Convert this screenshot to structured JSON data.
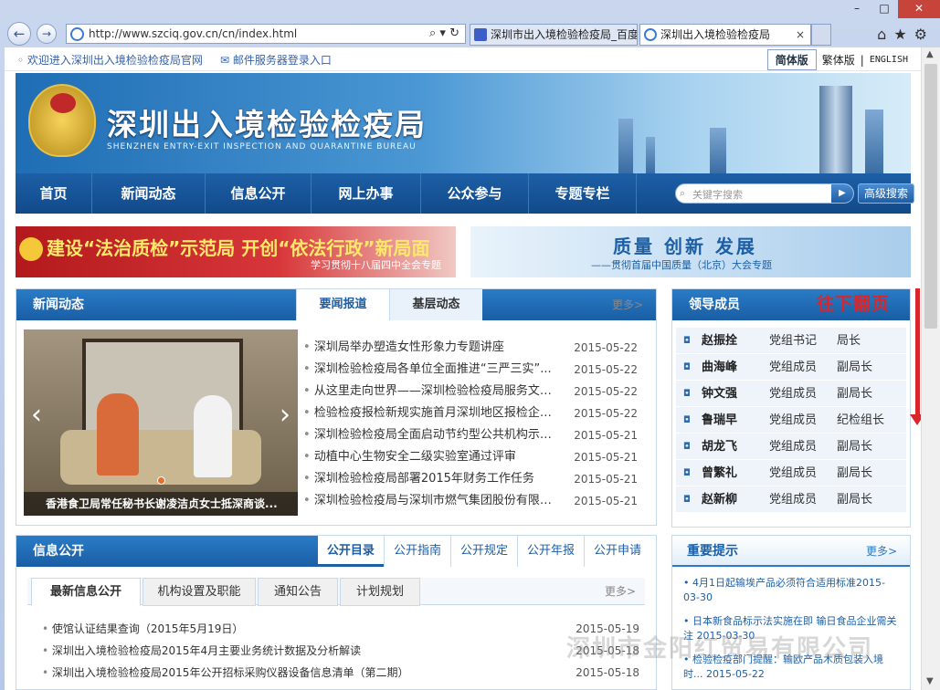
{
  "browser": {
    "url": "http://www.szciq.gov.cn/cn/index.html",
    "tabs": [
      {
        "label": "深圳市出入境检验检疫局_百度..."
      },
      {
        "label": "深圳出入境检验检疫局",
        "close": "×"
      }
    ],
    "nav": {
      "back": "←",
      "forward": "→",
      "refresh": "↻",
      "search": "⌕"
    },
    "window": {
      "min": "–",
      "max": "□",
      "close": "✕"
    },
    "tools": {
      "home": "⌂",
      "fav": "★",
      "settings": "⚙"
    }
  },
  "topbar": {
    "welcome": "欢迎进入深圳出入境检验检疫局官网",
    "mail": "邮件服务器登录入口",
    "lang_simplified": "简体版",
    "lang_traditional": "繁体版",
    "lang_sep": "|",
    "lang_english": "ENGLISH"
  },
  "header": {
    "title": "深圳出入境检验检疫局",
    "subtitle": "SHENZHEN ENTRY-EXIT INSPECTION AND QUARANTINE BUREAU"
  },
  "mainnav": {
    "items": [
      "首页",
      "新闻动态",
      "信息公开",
      "网上办事",
      "公众参与",
      "专题专栏"
    ],
    "search_placeholder": "关键字搜索",
    "search_go": "▶",
    "advanced": "高级搜索"
  },
  "promo": {
    "left_title": "建设“法治质检”示范局 开创“依法行政”新局面",
    "left_sub": "学习贯彻十八届四中全会专题",
    "right_title": "质量 创新 发展",
    "right_sub": "——贯彻首届中国质量（北京）大会专题"
  },
  "news": {
    "heading": "新闻动态",
    "tabs": [
      "要闻报道",
      "基层动态"
    ],
    "more": "更多>",
    "photo_caption": "香港食卫局常任秘书长谢凌洁贞女士抵深商谈...",
    "items": [
      {
        "title": "深圳局举办塑造女性形象力专题讲座",
        "date": "2015-05-22"
      },
      {
        "title": "深圳检验检疫局各单位全面推进“三严三实”...",
        "date": "2015-05-22"
      },
      {
        "title": "从这里走向世界——深圳检验检疫局服务文博...",
        "date": "2015-05-22"
      },
      {
        "title": "检验检疫报检新规实施首月深圳地区报检企业...",
        "date": "2015-05-22"
      },
      {
        "title": "深圳检验检疫局全面启动节约型公共机构示范...",
        "date": "2015-05-21"
      },
      {
        "title": "动植中心生物安全二级实验室通过评审",
        "date": "2015-05-21"
      },
      {
        "title": "深圳检验检疫局部署2015年财务工作任务",
        "date": "2015-05-21"
      },
      {
        "title": "深圳检验检疫局与深圳市燃气集团股份有限公...",
        "date": "2015-05-21"
      }
    ]
  },
  "leaders": {
    "heading": "领导成员",
    "rows": [
      {
        "name": "赵振拴",
        "role": "党组书记",
        "title": "局长"
      },
      {
        "name": "曲海峰",
        "role": "党组成员",
        "title": "副局长"
      },
      {
        "name": "钟文强",
        "role": "党组成员",
        "title": "副局长"
      },
      {
        "name": "鲁瑞早",
        "role": "党组成员",
        "title": "纪检组长"
      },
      {
        "name": "胡龙飞",
        "role": "党组成员",
        "title": "副局长"
      },
      {
        "name": "曾繁礼",
        "role": "党组成员",
        "title": "副局长"
      },
      {
        "name": "赵新柳",
        "role": "党组成员",
        "title": "副局长"
      }
    ]
  },
  "annotation": {
    "scroll_tip": "往下翻页"
  },
  "info": {
    "heading": "信息公开",
    "links": [
      "公开目录",
      "公开指南",
      "公开规定",
      "公开年报",
      "公开申请"
    ],
    "tabs": [
      "最新信息公开",
      "机构设置及职能",
      "通知公告",
      "计划规划"
    ],
    "more": "更多>",
    "items": [
      {
        "title": "使馆认证结果查询（2015年5月19日）",
        "date": "2015-05-19"
      },
      {
        "title": "深圳出入境检验检疫局2015年4月主要业务统计数据及分析解读",
        "date": "2015-05-18"
      },
      {
        "title": "深圳出入境检验检疫局2015年公开招标采购仪器设备信息清单（第二期）",
        "date": "2015-05-18"
      }
    ]
  },
  "tips": {
    "heading": "重要提示",
    "more": "更多>",
    "items": [
      "4月1日起输埃产品必须符合适用标准2015-03-30",
      "日本新食品标示法实施在即 输日食品企业需关注 2015-03-30",
      "检验检疫部门提醒：输欧产品木质包装入境时... 2015-05-22"
    ]
  },
  "watermark": "深圳市金阳红贸易有限公司",
  "colors": {
    "brand_blue": "#1d5fa6",
    "accent_red": "#d8262b"
  }
}
